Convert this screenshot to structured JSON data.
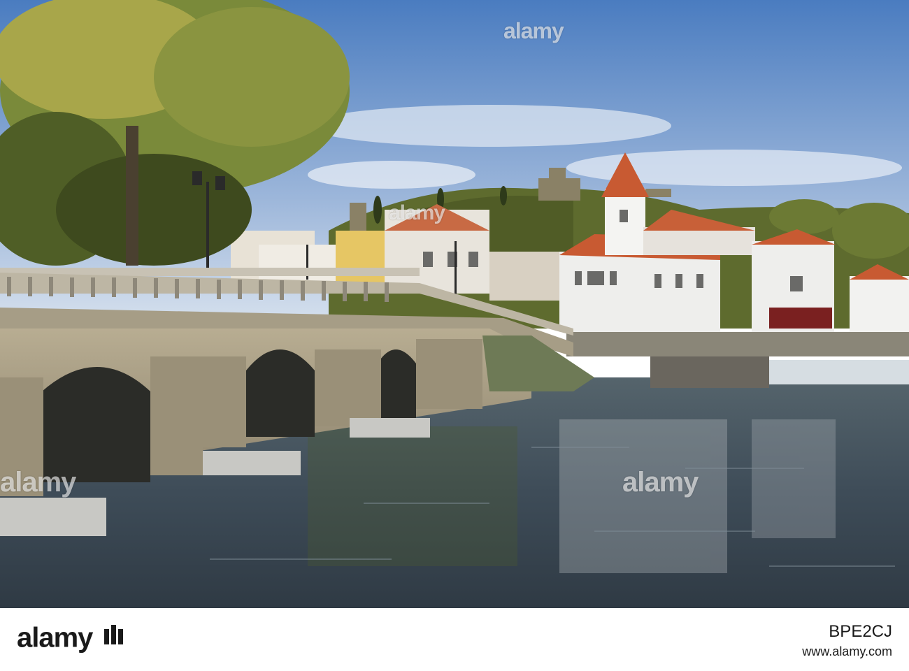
{
  "photo": {
    "colors": {
      "sky_top": "#4f7fc0",
      "sky_bottom": "#c9d8ec",
      "water": "#3a4a5a",
      "stone": "#a89e8a",
      "roof": "#c85a32",
      "foliage": "#5a6a2a"
    }
  },
  "watermarks": {
    "top": "alamy",
    "left": "alamy",
    "right": "alamy",
    "mid": "alamy"
  },
  "footer": {
    "logo": "alamy",
    "logo_icon": "alamy-logo-icon",
    "image_id": "BPE2CJ",
    "site": "www.alamy.com"
  }
}
